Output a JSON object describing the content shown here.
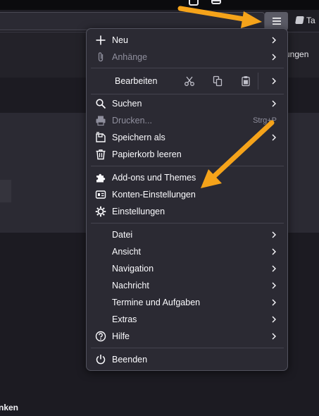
{
  "background": {
    "tab_fragment": "Ta",
    "right_text_fragment": "ungen",
    "bottom_text_fragment": "nken"
  },
  "menu": {
    "items_top": [
      {
        "label": "Neu",
        "icon": "plus-icon",
        "has_submenu": true,
        "disabled": false
      },
      {
        "label": "Anhänge",
        "icon": "paperclip-icon",
        "has_submenu": true,
        "disabled": true
      }
    ],
    "edit": {
      "label": "Bearbeiten",
      "icons": [
        "cut-icon",
        "copy-icon",
        "paste-icon"
      ],
      "has_submenu": true
    },
    "items_file": [
      {
        "label": "Suchen",
        "icon": "search-icon",
        "has_submenu": true,
        "disabled": false
      },
      {
        "label": "Drucken...",
        "icon": "printer-icon",
        "shortcut": "Strg+P",
        "disabled": true
      },
      {
        "label": "Speichern als",
        "icon": "save-as-icon",
        "has_submenu": true,
        "disabled": false
      },
      {
        "label": "Papierkorb leeren",
        "icon": "trash-icon",
        "disabled": false
      }
    ],
    "items_settings": [
      {
        "label": "Add-ons und Themes",
        "icon": "puzzle-icon"
      },
      {
        "label": "Konten-Einstellungen",
        "icon": "account-card-icon"
      },
      {
        "label": "Einstellungen",
        "icon": "gear-icon"
      }
    ],
    "items_sub": [
      {
        "label": "Datei",
        "has_submenu": true
      },
      {
        "label": "Ansicht",
        "has_submenu": true
      },
      {
        "label": "Navigation",
        "has_submenu": true
      },
      {
        "label": "Nachricht",
        "has_submenu": true
      },
      {
        "label": "Termine und Aufgaben",
        "has_submenu": true
      },
      {
        "label": "Extras",
        "has_submenu": true
      },
      {
        "label": "Hilfe",
        "icon": "help-icon",
        "has_submenu": true
      }
    ],
    "quit": {
      "label": "Beenden",
      "icon": "power-icon"
    }
  },
  "colors": {
    "panel_bg": "#2b2a33",
    "arrow": "#f5a31a",
    "text": "#fbfbfe",
    "disabled_text": "#8f8f9d"
  }
}
